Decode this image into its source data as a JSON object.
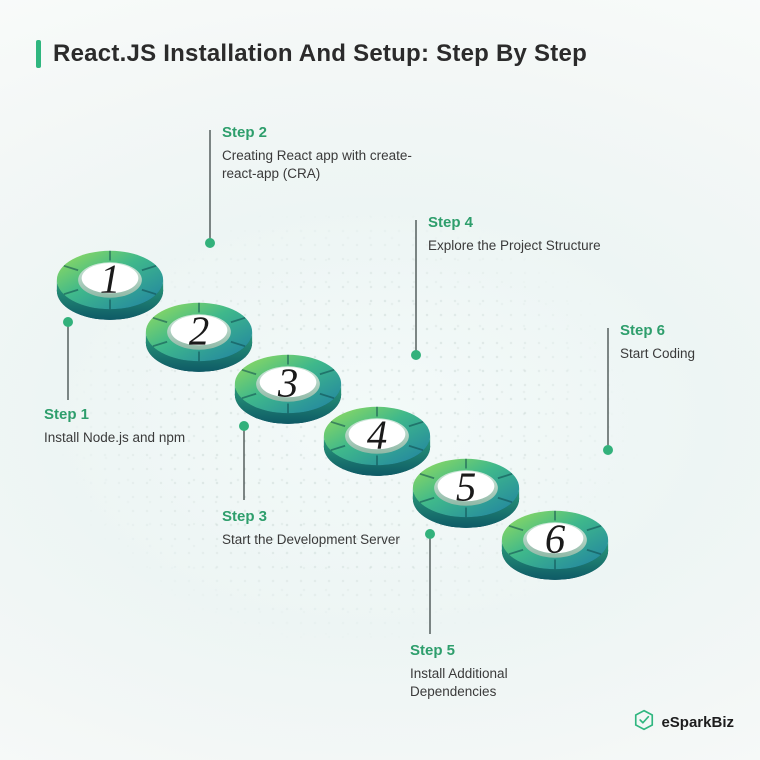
{
  "title": "React.JS Installation And Setup: Step By Step",
  "brand": {
    "name_part1": "eSpark",
    "name_part2": "Biz"
  },
  "accent_color": "#2fb67f",
  "steps": [
    {
      "n": "1",
      "label": "Step 1",
      "desc": "Install Node.js and npm"
    },
    {
      "n": "2",
      "label": "Step 2",
      "desc": "Creating React app with create-react-app (CRA)"
    },
    {
      "n": "3",
      "label": "Step 3",
      "desc": "Start the Development Server"
    },
    {
      "n": "4",
      "label": "Step 4",
      "desc": "Explore the Project Structure"
    },
    {
      "n": "5",
      "label": "Step 5",
      "desc": "Install Additional Dependencies"
    },
    {
      "n": "6",
      "label": "Step 6",
      "desc": "Start Coding"
    }
  ]
}
